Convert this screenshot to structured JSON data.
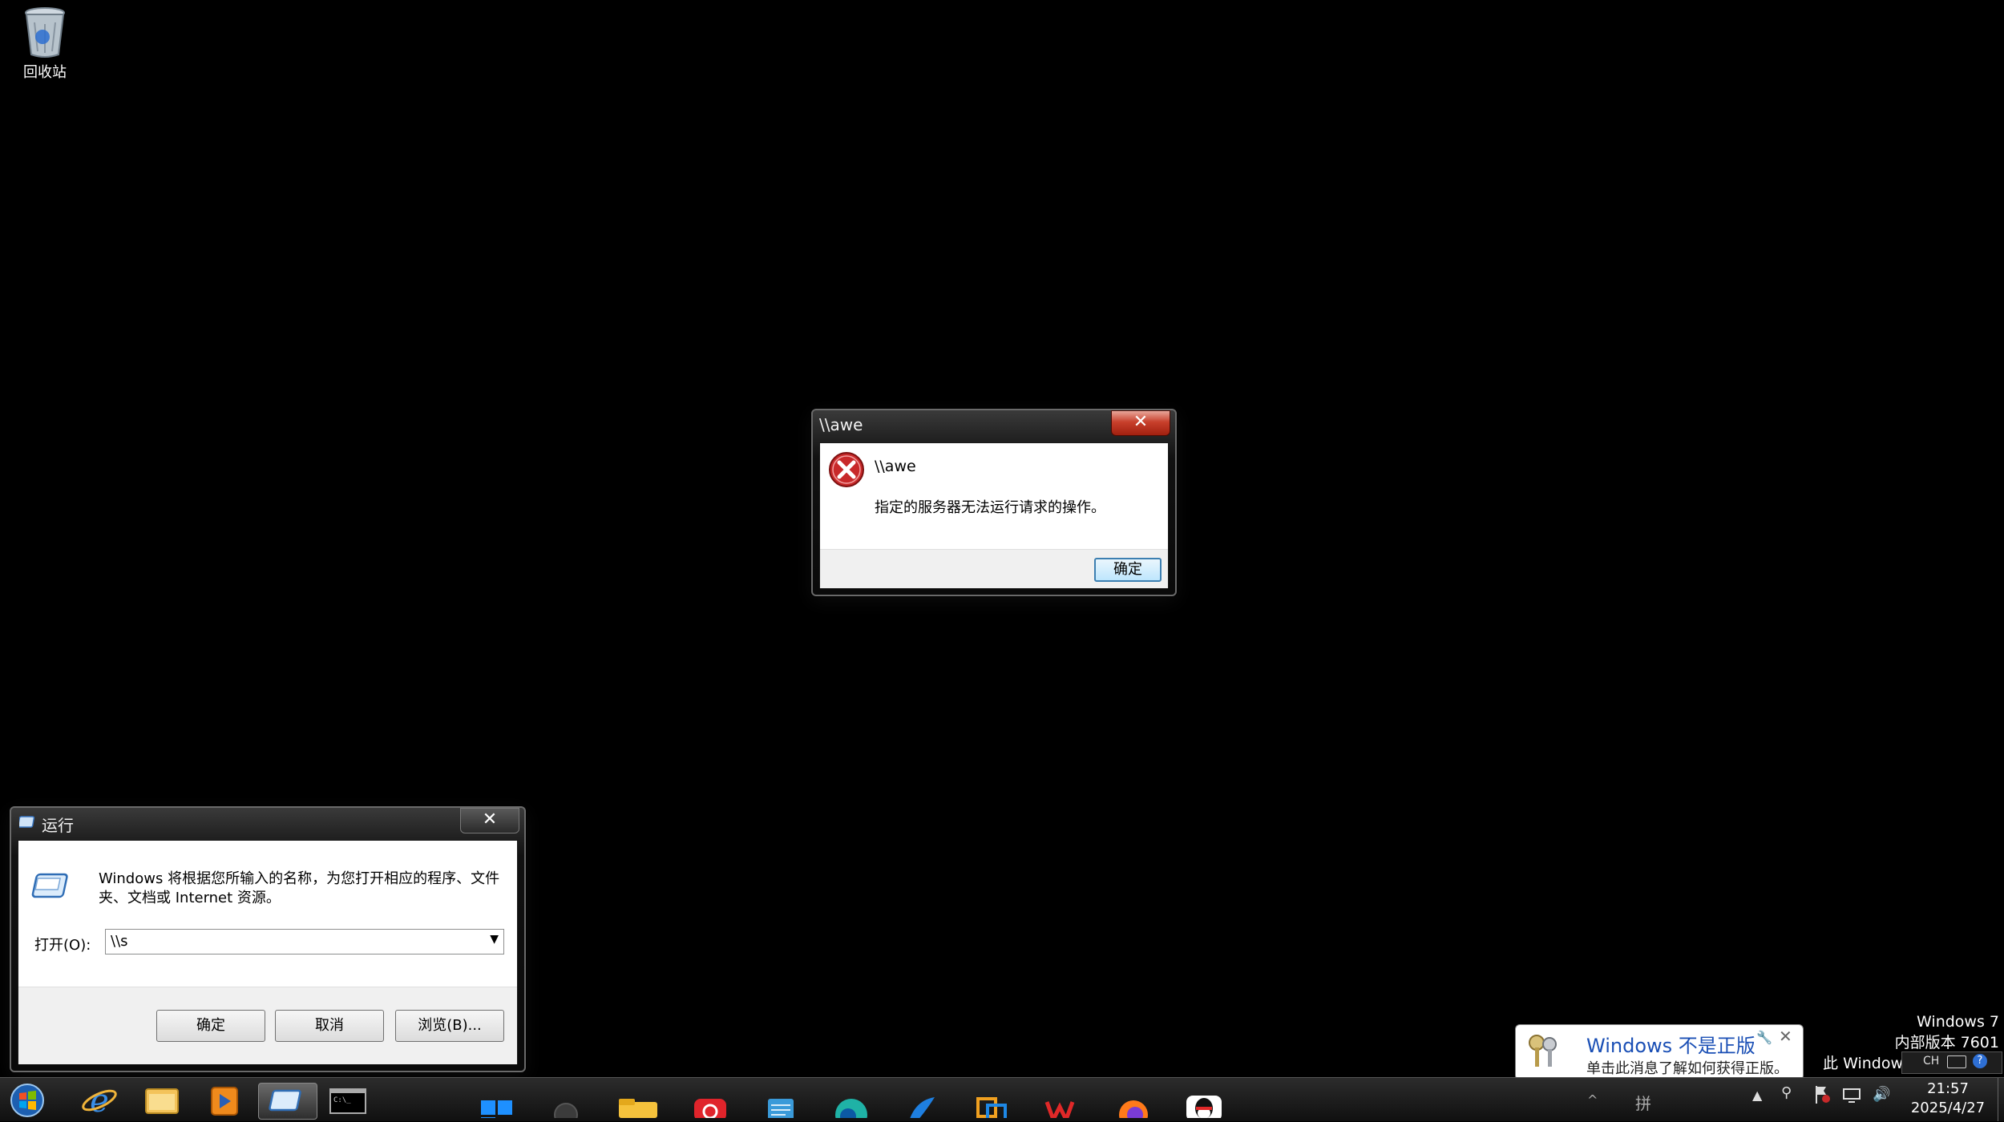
{
  "desktop": {
    "recycle_bin_label": "回收站",
    "watermark": {
      "line1": "Windows 7",
      "line2": "内部版本 7601",
      "line3": "此 Window"
    }
  },
  "error_dialog": {
    "title": "\\\\awe",
    "heading": "\\\\awe",
    "message": "指定的服务器无法运行请求的操作。",
    "ok_label": "确定",
    "close_label": "✕"
  },
  "run_dialog": {
    "title": "运行",
    "description_line1": "Windows 将根据您所输入的名称，为您打开相应的程序、文件",
    "description_line2": "夹、文档或 Internet 资源。",
    "open_label": "打开(O):",
    "input_value": "\\\\s",
    "ok_label": "确定",
    "cancel_label": "取消",
    "browse_label": "浏览(B)...",
    "close_label": "✕"
  },
  "balloon": {
    "title": "Windows 不是正版",
    "message": "单击此消息了解如何获得正版。"
  },
  "tray": {
    "time": "21:57",
    "date": "2025/4/27",
    "ime_label": "CH",
    "ime_char": "拼"
  },
  "taskbar_icons": [
    "start-orb-icon",
    "internet-explorer-icon",
    "file-explorer-icon",
    "media-player-icon",
    "run-app-icon",
    "cmd-icon",
    "windows11-start-icon",
    "search-circle-icon",
    "folder-icon",
    "netease-music-icon",
    "notepad-icon",
    "edge-icon",
    "feather-app-icon",
    "vmware-icon",
    "wps-icon",
    "firefox-icon",
    "qq-icon"
  ],
  "colors": {
    "error_red": "#c8292a",
    "link_blue": "#1a4fb5",
    "taskbar": "#1a1a1a"
  }
}
